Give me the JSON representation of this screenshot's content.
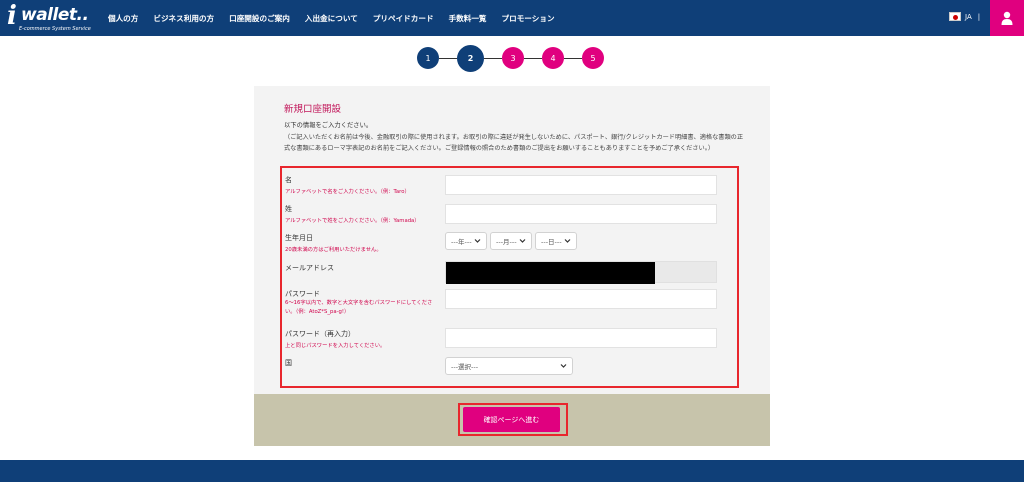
{
  "header": {
    "logo": {
      "mark": "i",
      "word": "wallet..",
      "tagline": "E-commerce System Service"
    },
    "nav": [
      "個人の方",
      "ビジネス利用の方",
      "口座開設のご案内",
      "入出金について",
      "プリペイドカード",
      "手数料一覧",
      "プロモーション"
    ],
    "language": "JA",
    "language_separator": "|",
    "colors": {
      "header_bg": "#0f3f78",
      "accent": "#e0007f"
    }
  },
  "stepper": {
    "steps": [
      "1",
      "2",
      "3",
      "4",
      "5"
    ],
    "current": 2
  },
  "form": {
    "title": "新規口座開設",
    "subtitle": "以下の情報をご入力ください。",
    "note": "（ご記入いただくお名前は今後、金融取引の際に使用されます。お取引の際に違延が発生しないために、パスポート、銀行/クレジットカード明細書、適格な書類の正式な書類にあるローマ字表記のお名前をご記入ください。ご登録情報の照合のため書類のご提出をお願いすることもありますことを予めご了承ください。）",
    "fields": {
      "first_name": {
        "label": "名",
        "hint": "アルファベットで名をご入力ください。（例：Taro）"
      },
      "last_name": {
        "label": "姓",
        "hint": "アルファベットで姓をご入力ください。（例：Yamada）"
      },
      "birthdate": {
        "label": "生年月日",
        "hint": "20歳未満の方はご利用いただけません。",
        "year": "---年---",
        "month": "---月---",
        "day": "---日---"
      },
      "email": {
        "label": "メールアドレス"
      },
      "password": {
        "label": "パスワード",
        "hint": "6～16字以内で、数字と大文字を含むパスワードにしてください。（例：AtoZ*S_pa-g!）"
      },
      "password_confirm": {
        "label": "パスワード（再入力）",
        "hint": "上と同じパスワードを入力してください。"
      },
      "country": {
        "label": "国",
        "placeholder": "---選択---"
      }
    },
    "submit_label": "確認ページへ進む"
  }
}
